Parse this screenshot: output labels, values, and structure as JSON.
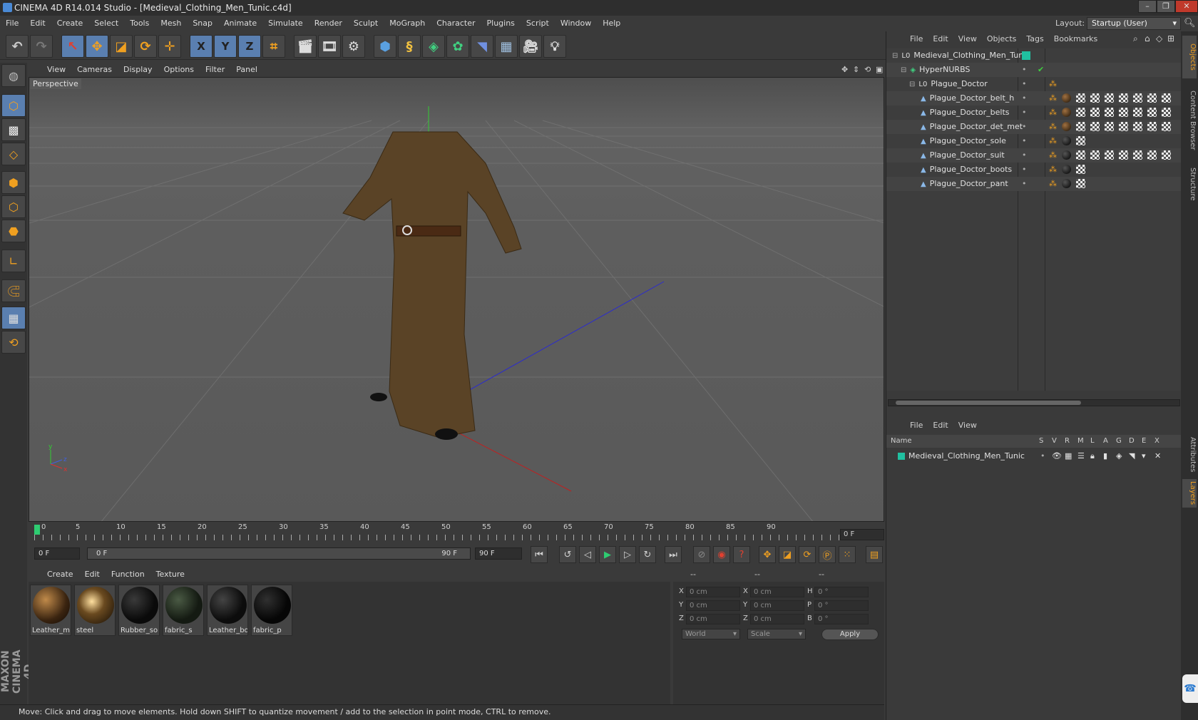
{
  "window": {
    "title": "CINEMA 4D R14.014 Studio - [Medieval_Clothing_Men_Tunic.c4d]"
  },
  "menu": [
    "File",
    "Edit",
    "Create",
    "Select",
    "Tools",
    "Mesh",
    "Snap",
    "Animate",
    "Simulate",
    "Render",
    "Sculpt",
    "MoGraph",
    "Character",
    "Plugins",
    "Script",
    "Window",
    "Help"
  ],
  "layout": {
    "label": "Layout:",
    "value": "Startup (User)"
  },
  "toolbar": {
    "x_label": "X",
    "y_label": "Y",
    "z_label": "Z"
  },
  "viewport": {
    "menu": [
      "View",
      "Cameras",
      "Display",
      "Options",
      "Filter",
      "Panel"
    ],
    "label": "Perspective",
    "axis": {
      "y": "y",
      "z": "z",
      "x": "x"
    }
  },
  "timeline": {
    "ticks": [
      "0",
      "5",
      "10",
      "15",
      "20",
      "25",
      "30",
      "35",
      "40",
      "45",
      "50",
      "55",
      "60",
      "65",
      "70",
      "75",
      "80",
      "85",
      "90"
    ],
    "frame_readout": "0 F",
    "start_field": "0 F",
    "range_start": "0 F",
    "range_end": "90 F",
    "end_field": "90 F"
  },
  "materials": {
    "menu": [
      "Create",
      "Edit",
      "Function",
      "Texture"
    ],
    "items": [
      {
        "label": "Leather_m",
        "color": "#7a4a20"
      },
      {
        "label": "steel",
        "color": "#9a7030"
      },
      {
        "label": "Rubber_so",
        "color": "#1a1a1a"
      },
      {
        "label": "fabric_s",
        "color": "#2c3a2a"
      },
      {
        "label": "Leather_bo",
        "color": "#202020"
      },
      {
        "label": "fabric_p",
        "color": "#151515"
      }
    ]
  },
  "coords": {
    "head": [
      "--",
      "--",
      "--"
    ],
    "rows": [
      {
        "a": "X",
        "av": "0 cm",
        "b": "X",
        "bv": "0 cm",
        "c": "H",
        "cv": "0 °"
      },
      {
        "a": "Y",
        "av": "0 cm",
        "b": "Y",
        "bv": "0 cm",
        "c": "P",
        "cv": "0 °"
      },
      {
        "a": "Z",
        "av": "0 cm",
        "b": "Z",
        "bv": "0 cm",
        "c": "B",
        "cv": "0 °"
      }
    ],
    "world": "World",
    "scale": "Scale",
    "apply": "Apply"
  },
  "status": "Move: Click and drag to move elements. Hold down SHIFT to quantize movement / add to the selection in point mode, CTRL to remove.",
  "objects": {
    "menu": [
      "File",
      "Edit",
      "View",
      "Objects",
      "Tags",
      "Bookmarks"
    ],
    "items": [
      {
        "name": "Medieval_Clothing_Men_Tunic",
        "type": "null"
      },
      {
        "name": "HyperNURBS",
        "type": "nurbs"
      },
      {
        "name": "Plague_Doctor",
        "type": "null"
      },
      {
        "name": "Plague_Doctor_belt_h",
        "type": "mesh"
      },
      {
        "name": "Plague_Doctor_belts",
        "type": "mesh"
      },
      {
        "name": "Plague_Doctor_det_met",
        "type": "mesh"
      },
      {
        "name": "Plague_Doctor_sole",
        "type": "mesh"
      },
      {
        "name": "Plague_Doctor_suit",
        "type": "mesh"
      },
      {
        "name": "Plague_Doctor_boots",
        "type": "mesh"
      },
      {
        "name": "Plague_Doctor_pant",
        "type": "mesh"
      }
    ]
  },
  "layers": {
    "menu": [
      "File",
      "Edit",
      "View"
    ],
    "columns": [
      "Name",
      "S",
      "V",
      "R",
      "M",
      "L",
      "A",
      "G",
      "D",
      "E",
      "X"
    ],
    "items": [
      {
        "name": "Medieval_Clothing_Men_Tunic",
        "color": "#20c0a0"
      }
    ]
  },
  "side_tabs": [
    "Objects",
    "Content Browser",
    "Structure",
    "Attributes",
    "Layers"
  ],
  "maxon": "MAXON CINEMA 4D"
}
